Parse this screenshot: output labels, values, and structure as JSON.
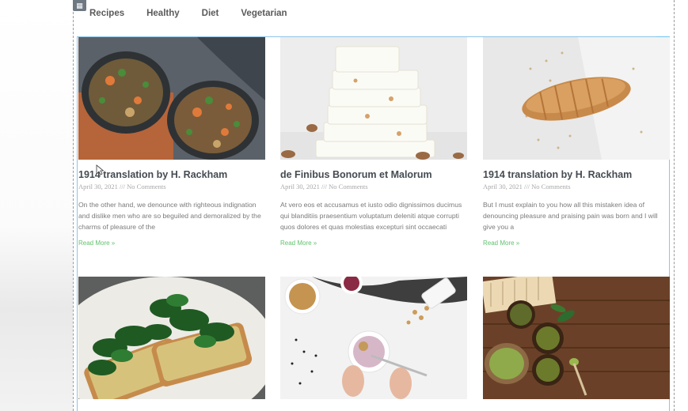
{
  "nav": {
    "items": [
      "Recipes",
      "Healthy",
      "Diet",
      "Vegetarian"
    ]
  },
  "posts": [
    {
      "title": "1914 translation by H. Rackham",
      "date": "April 30, 2021",
      "separator": "///",
      "comments": "No Comments",
      "excerpt": "On the other hand, we denounce with righteous indignation and dislike men who are so beguiled and demoralized by the charms of pleasure of the",
      "read_more": "Read More »",
      "image": "food-bowls-image"
    },
    {
      "title": "de Finibus Bonorum et Malorum",
      "date": "April 30, 2021",
      "separator": "///",
      "comments": "No Comments",
      "excerpt": "At vero eos et accusamus et iusto odio dignissimos ducimus qui blanditiis praesentium voluptatum deleniti atque corrupti quos dolores et quas molestias excepturi sint occaecati",
      "read_more": "Read More »",
      "image": "white-chocolate-image"
    },
    {
      "title": "1914 translation by H. Rackham",
      "date": "April 30, 2021",
      "separator": "///",
      "comments": "No Comments",
      "excerpt": "But I must explain to you how all this mistaken idea of denouncing pleasure and praising pain was born and I will give you a",
      "read_more": "Read More »",
      "image": "bread-loaf-image"
    },
    {
      "image": "spinach-toast-image"
    },
    {
      "image": "smoothie-bowl-image"
    },
    {
      "image": "matcha-tea-image"
    }
  ],
  "colors": {
    "accent_link": "#61c26e",
    "editor_frame": "#8ec4ea",
    "edit_handle": "#71c6ee",
    "title_text": "#444b52"
  }
}
